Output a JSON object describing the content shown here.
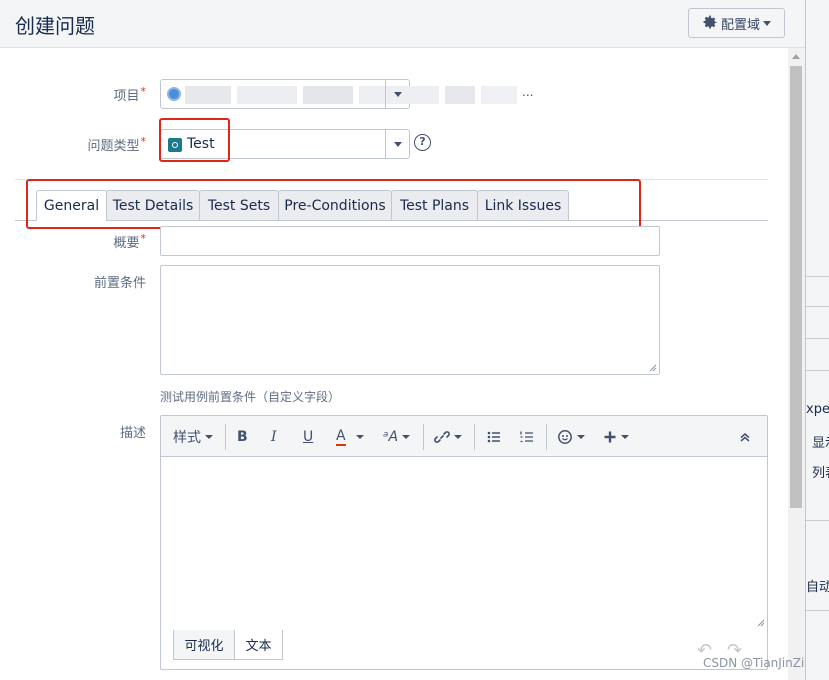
{
  "dialog": {
    "title": "创建问题",
    "config_label": "配置域"
  },
  "form": {
    "project_label": "项目",
    "project_value_suffix": "...",
    "issue_type_label": "问题类型",
    "issue_type_value": "Test",
    "required_mark": "*",
    "help_mark": "?"
  },
  "tabs": [
    {
      "label": "General",
      "active": true
    },
    {
      "label": "Test Details",
      "active": false
    },
    {
      "label": "Test Sets",
      "active": false
    },
    {
      "label": "Pre-Conditions",
      "active": false
    },
    {
      "label": "Test Plans",
      "active": false
    },
    {
      "label": "Link Issues",
      "active": false
    }
  ],
  "fields": {
    "summary_label": "概要",
    "summary_value": "",
    "precondition_label": "前置条件",
    "precondition_value": "",
    "precondition_hint": "测试用例前置条件（自定义字段）",
    "description_label": "描述"
  },
  "editor": {
    "style_label": "样式",
    "bold": "B",
    "italic": "I",
    "underline": "U",
    "text_color": "A",
    "font_size": "ᵃA",
    "mode_visual": "可视化",
    "mode_text": "文本",
    "active_mode": "文本"
  },
  "background_strip": {
    "texts": [
      "xpec",
      "显示",
      "列表",
      "自动编"
    ]
  },
  "watermark": "CSDN @TianJinZi",
  "colors": {
    "required": "#de350b",
    "highlight_box": "#e0251b",
    "type_icon": "#1d7a8c"
  }
}
